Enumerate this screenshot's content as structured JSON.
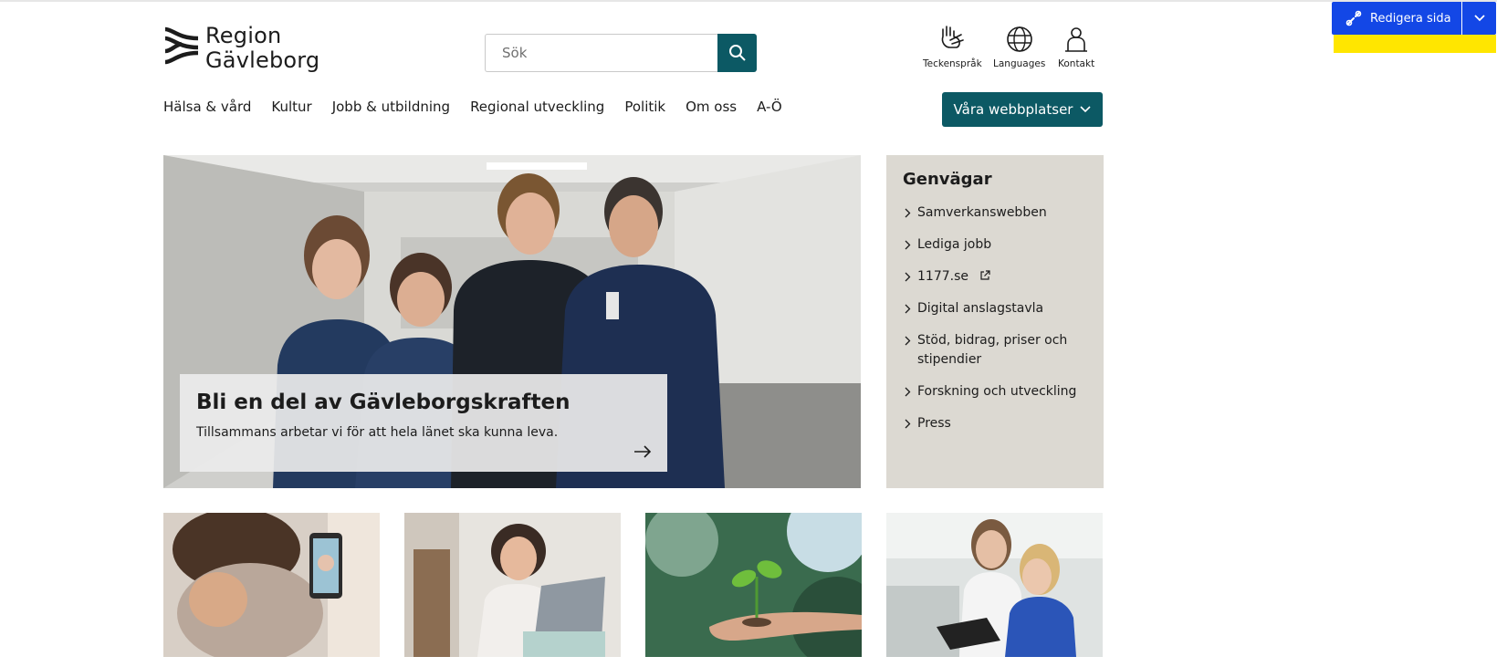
{
  "header": {
    "logo_line1": "Region",
    "logo_line2": "Gävleborg",
    "search_placeholder": "Sök",
    "utility": [
      {
        "label": "Teckenspråk",
        "icon": "sign-language-icon"
      },
      {
        "label": "Languages",
        "icon": "globe-icon"
      },
      {
        "label": "Kontakt",
        "icon": "contact-icon"
      }
    ]
  },
  "nav": {
    "items": [
      "Hälsa & vård",
      "Kultur",
      "Jobb & utbildning",
      "Regional utveckling",
      "Politik",
      "Om oss",
      "A-Ö"
    ],
    "sites_button": "Våra webbplatser"
  },
  "editor": {
    "edit_label": "Redigera sida"
  },
  "hero": {
    "title": "Bli en del av Gävleborgskraften",
    "text": "Tillsammans arbetar vi för att hela länet ska kunna leva."
  },
  "shortcuts": {
    "title": "Genvägar",
    "items": [
      "Samverkanswebben",
      "Lediga jobb",
      "1177.se",
      "Digital anslagstavla",
      "Stöd, bidrag, priser och stipendier",
      "Forskning och utveckling",
      "Press"
    ]
  },
  "colors": {
    "brand_teal": "#0c5964",
    "editor_blue": "#1347e6",
    "editor_yellow": "#ffe600",
    "shortcuts_bg": "#dcd9d2"
  }
}
